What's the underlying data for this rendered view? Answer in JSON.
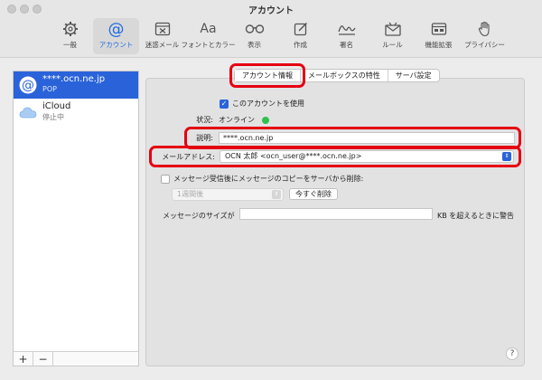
{
  "window": {
    "title": "アカウント"
  },
  "toolbar": {
    "items": [
      {
        "label": "一般",
        "icon": "gear-icon"
      },
      {
        "label": "アカウント",
        "icon": "at-icon",
        "active": true
      },
      {
        "label": "迷惑メール",
        "icon": "junk-icon"
      },
      {
        "label": "フォントとカラー",
        "icon": "font-icon",
        "glyph": "Aa"
      },
      {
        "label": "表示",
        "icon": "glasses-icon"
      },
      {
        "label": "作成",
        "icon": "compose-icon"
      },
      {
        "label": "署名",
        "icon": "signature-icon"
      },
      {
        "label": "ルール",
        "icon": "rules-icon"
      },
      {
        "label": "機能拡張",
        "icon": "extensions-icon"
      },
      {
        "label": "プライバシー",
        "icon": "hand-icon"
      }
    ]
  },
  "sidebar": {
    "accounts": [
      {
        "name": "****.ocn.ne.jp",
        "type": "POP",
        "icon": "at-icon",
        "selected": true
      },
      {
        "name": "iCloud",
        "type": "停止中",
        "icon": "cloud-icon",
        "selected": false
      }
    ],
    "add_label": "+",
    "remove_label": "−"
  },
  "tabs": [
    {
      "label": "アカウント情報",
      "active": true
    },
    {
      "label": "メールボックスの特性"
    },
    {
      "label": "サーバ設定"
    }
  ],
  "form": {
    "enable_label": "このアカウントを使用",
    "status_label": "状況:",
    "status_value": "オンライン",
    "description_label": "説明:",
    "description_value": "****.ocn.ne.jp",
    "email_label": "メールアドレス:",
    "email_value": "OCN 太郎 <ocn_user@****.ocn.ne.jp>",
    "remove_copy_label": "メッセージ受信後にメッセージのコピーをサーバから削除:",
    "remove_after_value": "1週間後",
    "remove_now_label": "今すぐ削除",
    "size_label": "メッセージのサイズが",
    "size_value": "",
    "size_suffix": "KB を超えるときに警告",
    "help_label": "?"
  },
  "colors": {
    "accent": "#2a63d9",
    "highlight": "#e50012",
    "online": "#2ec24a"
  }
}
